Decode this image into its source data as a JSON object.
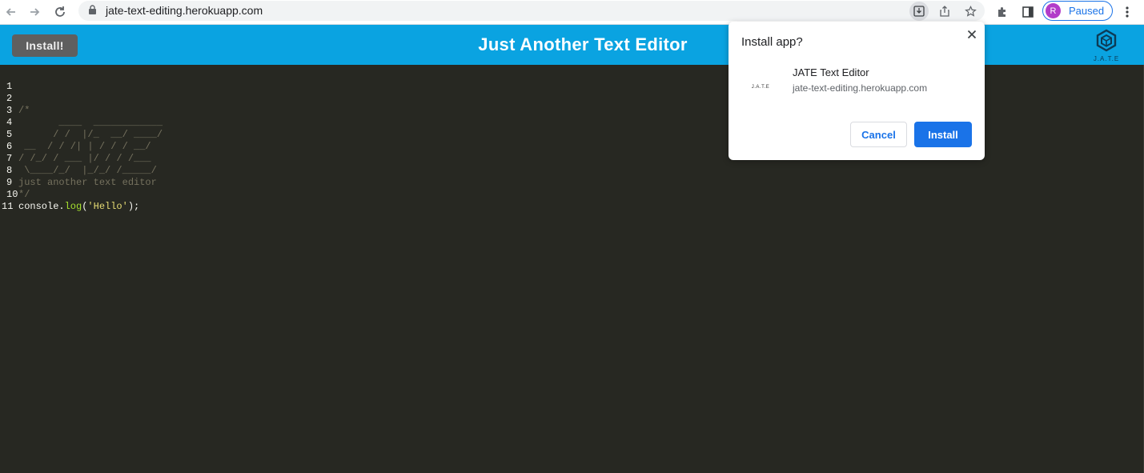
{
  "browser": {
    "url": "jate-text-editing.herokuapp.com",
    "profile_initial": "R",
    "profile_status": "Paused"
  },
  "app": {
    "install_label": "Install!",
    "title": "Just Another Text Editor",
    "logo_text": "J.A.T.E"
  },
  "editor": {
    "lines": [
      {
        "num": "1",
        "text": ""
      },
      {
        "num": "2",
        "text": "/*"
      },
      {
        "num": "3",
        "text": "       ____  ____________"
      },
      {
        "num": "4",
        "text": "      / /  |/_  __/ ____/"
      },
      {
        "num": "5",
        "text": " __  / / /| | / / / __/"
      },
      {
        "num": "6",
        "text": "/ /_/ / ___ |/ / / /___"
      },
      {
        "num": "7",
        "text": " \\____/_/  |_/_/ /_____/"
      },
      {
        "num": "8",
        "text": "just another text editor"
      },
      {
        "num": "9",
        "text": "*/"
      },
      {
        "num": "10",
        "text": ""
      },
      {
        "num": "11",
        "text": ""
      }
    ],
    "code_line": {
      "obj": "console.",
      "method": "log",
      "open": "(",
      "string": "'Hello'",
      "close": ");"
    }
  },
  "dialog": {
    "title": "Install app?",
    "app_name": "JATE Text Editor",
    "app_origin": "jate-text-editing.herokuapp.com",
    "app_icon_text": "J.A.T.E",
    "cancel_label": "Cancel",
    "install_label": "Install"
  },
  "colors": {
    "header_bg": "#0aa3e1",
    "editor_bg": "#272822",
    "accent": "#1a73e8"
  }
}
